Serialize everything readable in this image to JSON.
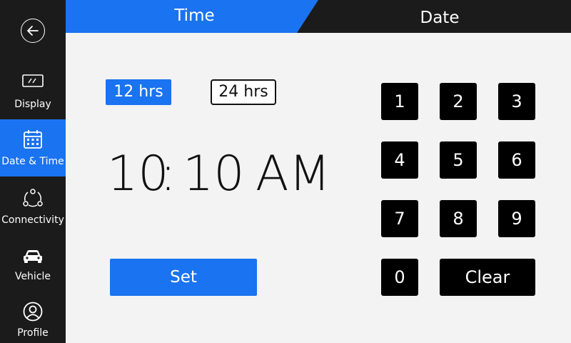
{
  "sidebar": {
    "back_icon": "arrow-left-circle-icon",
    "items": [
      {
        "label": "Display",
        "icon": "display-icon"
      },
      {
        "label": "Date & Time",
        "icon": "calendar-icon",
        "active": true
      },
      {
        "label": "Connectivity",
        "icon": "network-icon"
      },
      {
        "label": "Vehicle",
        "icon": "car-icon"
      },
      {
        "label": "Profile",
        "icon": "user-icon"
      }
    ]
  },
  "tabs": {
    "time": "Time",
    "date": "Date",
    "active": "Time"
  },
  "format": {
    "h12": "12 hrs",
    "h24": "24 hrs",
    "selected": "12 hrs"
  },
  "time": {
    "hour": "10",
    "separator": ":",
    "minute": "10",
    "period": "AM"
  },
  "set_label": "Set",
  "keypad": {
    "k1": "1",
    "k2": "2",
    "k3": "3",
    "k4": "4",
    "k5": "5",
    "k6": "6",
    "k7": "7",
    "k8": "8",
    "k9": "9",
    "k0": "0",
    "clear": "Clear"
  },
  "colors": {
    "accent": "#1a73f0",
    "sidebar_bg": "#1b1b1b",
    "content_bg": "#f3f3f3",
    "key_bg": "#000000"
  }
}
